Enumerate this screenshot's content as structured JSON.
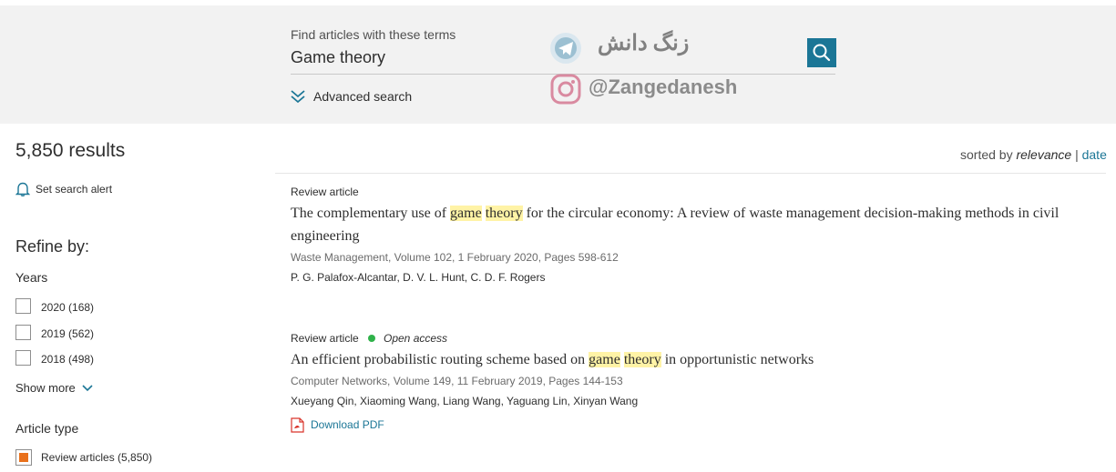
{
  "search": {
    "field_label": "Find articles with these terms",
    "value": "Game theory",
    "advanced_label": "Advanced search"
  },
  "watermark": {
    "brand_text": "زنگ دانش",
    "handle": "@Zangedanesh"
  },
  "results": {
    "count_text": "5,850 results",
    "set_alert_label": "Set search alert",
    "sorted_by_prefix": "sorted by",
    "sort_relevance": "relevance",
    "sort_separator": "|",
    "sort_date": "date"
  },
  "refine": {
    "heading": "Refine by:",
    "years_label": "Years",
    "years": [
      {
        "label": "2020 (168)",
        "checked": false
      },
      {
        "label": "2019 (562)",
        "checked": false
      },
      {
        "label": "2018 (498)",
        "checked": false
      }
    ],
    "show_more_label": "Show more",
    "article_type_label": "Article type",
    "article_types": [
      {
        "label": "Review articles (5,850)",
        "checked": true
      }
    ]
  },
  "articles": [
    {
      "type": "Review article",
      "open_access": false,
      "title_parts": [
        "The complementary use of ",
        "game",
        " ",
        "theory",
        " for the circular economy: A review of waste management decision-making methods in civil engineering"
      ],
      "source": "Waste Management, Volume 102, 1 February 2020, Pages 598-612",
      "authors": "P. G. Palafox-Alcantar, D. V. L. Hunt, C. D. F. Rogers"
    },
    {
      "type": "Review article",
      "open_access": true,
      "open_access_label": "Open access",
      "title_parts": [
        "An efficient probabilistic routing scheme based on ",
        "game",
        " ",
        "theory",
        " in opportunistic networks"
      ],
      "source": "Computer Networks, Volume 149, 11 February 2019, Pages 144-153",
      "authors": "Xueyang Qin, Xiaoming Wang, Liang Wang, Yaguang Lin, Xinyan Wang",
      "download_label": "Download PDF"
    }
  ],
  "colors": {
    "accent": "#1b7696",
    "highlight": "#fff3a6",
    "checkbox_fill": "#e9711c",
    "open_access": "#2fb24a"
  },
  "icons": [
    "search-icon",
    "chevron-down-icon",
    "bell-icon",
    "pdf-icon",
    "telegram-icon",
    "instagram-icon"
  ]
}
